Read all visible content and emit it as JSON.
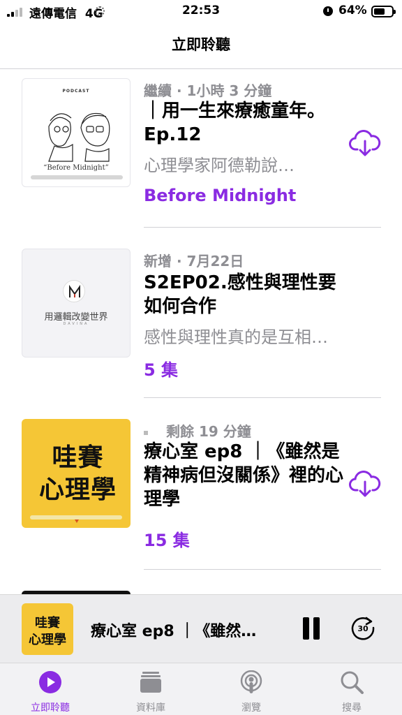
{
  "status_bar": {
    "carrier": "遠傳電信",
    "network": "4G",
    "time": "22:53",
    "battery_percent": "64%",
    "battery_level": 0.64
  },
  "nav": {
    "title": "立即聆聽"
  },
  "episodes": [
    {
      "meta": "繼續 · 1小時 3 分鐘",
      "title": "｜用一生來療癒童年。Ep.12",
      "description": "心理學家阿德勒說…",
      "show": "Before Midnight",
      "artwork": {
        "label": "PODCAST",
        "name": "“Before Midnight”"
      },
      "download_icon": "cloud-download-icon"
    },
    {
      "meta": "新增 · 7月22日",
      "title": "S2EP02.感性與理性要如何合作",
      "description": "感性與理性真的是互相…",
      "show": "5 集",
      "artwork": {
        "title": "用邏輯改變世界",
        "subtitle": "DAVINA"
      }
    },
    {
      "meta": "剩餘 19 分鐘",
      "title": "療心室 ep8 ｜《雖然是精神病但沒關係》裡的心理學",
      "show": "15 集",
      "artwork": {
        "line1": "哇賽",
        "line2": "心理學"
      },
      "download_icon": "cloud-download-icon"
    }
  ],
  "mini_player": {
    "title": "療心室 ep8 ｜《雖然…",
    "artwork": {
      "line1": "哇賽",
      "line2": "心理學"
    },
    "skip_seconds": "30"
  },
  "tabs": [
    {
      "label": "立即聆聽",
      "icon": "play-circle-icon",
      "active": true
    },
    {
      "label": "資料庫",
      "icon": "library-stack-icon",
      "active": false
    },
    {
      "label": "瀏覽",
      "icon": "podcast-browse-icon",
      "active": false
    },
    {
      "label": "搜尋",
      "icon": "search-icon",
      "active": false
    }
  ],
  "colors": {
    "accent": "#8a2be2",
    "secondary_text": "#8e8e93",
    "artwork_yellow": "#f5c636"
  }
}
